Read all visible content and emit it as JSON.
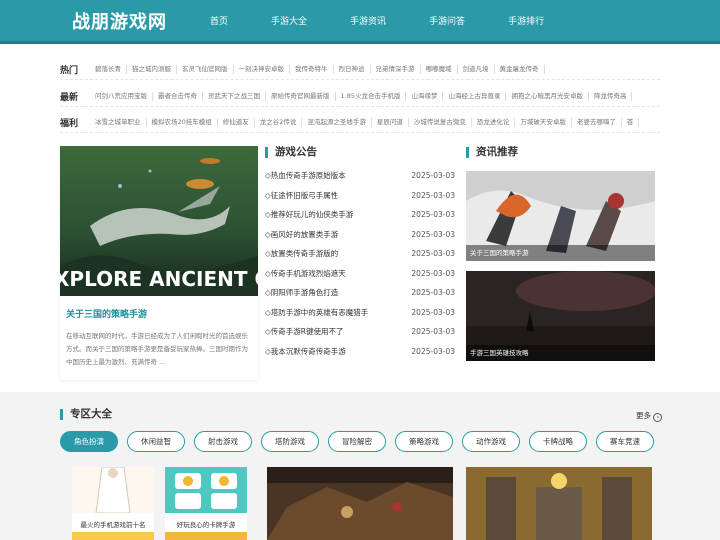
{
  "header": {
    "logo": "战朋游戏网",
    "nav": [
      "首页",
      "手游大全",
      "手游资讯",
      "手游问答",
      "手游排行"
    ]
  },
  "tags": {
    "hot": {
      "label": "热门",
      "items": [
        "碧落长青",
        "猫之城内测服",
        "玄灵飞仙官网版",
        "一刻决神安卓版",
        "我传奇特牛",
        "烈日神途",
        "兄弟情深手游",
        "嘟嘟魔域",
        "剑道凡境",
        "黄金屠龙传奇"
      ]
    },
    "new": {
      "label": "最新",
      "items": [
        "问剑八荒应用宝版",
        "霸者合击传奇",
        "灵武天下之战三国",
        "原始传奇官网最新版",
        "1.85火龙合击手机版",
        "山海缘梦",
        "山海经上古异兽录",
        "拥抱之心暗黑月光安卓版",
        "降龙传奇高"
      ]
    },
    "welfare": {
      "label": "福利",
      "items": [
        "冰雪之城单职业",
        "模拟农场20挂车模组",
        "修仙道友",
        "龙之谷2传说",
        "混沌起源之圣墟手游",
        "星辰问道",
        "沙城传说复古微变",
        "恐龙进化论",
        "万域破天安卓版",
        "老婆去哪嗨了",
        "苍"
      ]
    }
  },
  "feature": {
    "image_text": "XPLORE ANCIENT OCEAN",
    "title": "关于三国的策略手游",
    "desc": "在移动互联网的时代，手游已经成为了人们闲暇时光的首选娱乐方式。而关于三国的策略手游更是备受玩家热捧。三国时期作为中国历史上最为激烈、充满传奇 ..."
  },
  "announcements": {
    "title": "游戏公告",
    "items": [
      {
        "title": "◇热血传奇手游原始版本",
        "date": "2025-03-03"
      },
      {
        "title": "◇征途怀旧版弓手属性",
        "date": "2025-03-03"
      },
      {
        "title": "◇推荐好玩儿的仙侠类手游",
        "date": "2025-03-03"
      },
      {
        "title": "◇画风好的放置类手游",
        "date": "2025-03-03"
      },
      {
        "title": "◇放置类传奇手游版的",
        "date": "2025-03-03"
      },
      {
        "title": "◇传奇手机游戏烈焰遮天",
        "date": "2025-03-03"
      },
      {
        "title": "◇阴阳师手游角色打造",
        "date": "2025-03-03"
      },
      {
        "title": "◇塔防手游中的英雄有恶魔猎手",
        "date": "2025-03-03"
      },
      {
        "title": "◇传奇手游R键使用不了",
        "date": "2025-03-03"
      },
      {
        "title": "◇我本沉默传奇传奇手游",
        "date": "2025-03-03"
      }
    ]
  },
  "recommend": {
    "title": "资讯推荐",
    "items": [
      {
        "caption": "关于三国的策略手游"
      },
      {
        "caption": "手游三国英雄技攻略"
      }
    ]
  },
  "zone": {
    "title": "专区大全",
    "more": "更多",
    "categories": [
      "角色扮演",
      "休闲益智",
      "射击游戏",
      "塔防游戏",
      "冒险解密",
      "策略游戏",
      "动作游戏",
      "卡牌战略",
      "赛车竞速"
    ],
    "cards": [
      {
        "caption": "最火的手机游戏前十名"
      },
      {
        "caption": "好玩良心的卡牌手游"
      }
    ]
  },
  "colors": {
    "brand": "#2a9aa8",
    "brand_dark": "#1f7f8b"
  }
}
